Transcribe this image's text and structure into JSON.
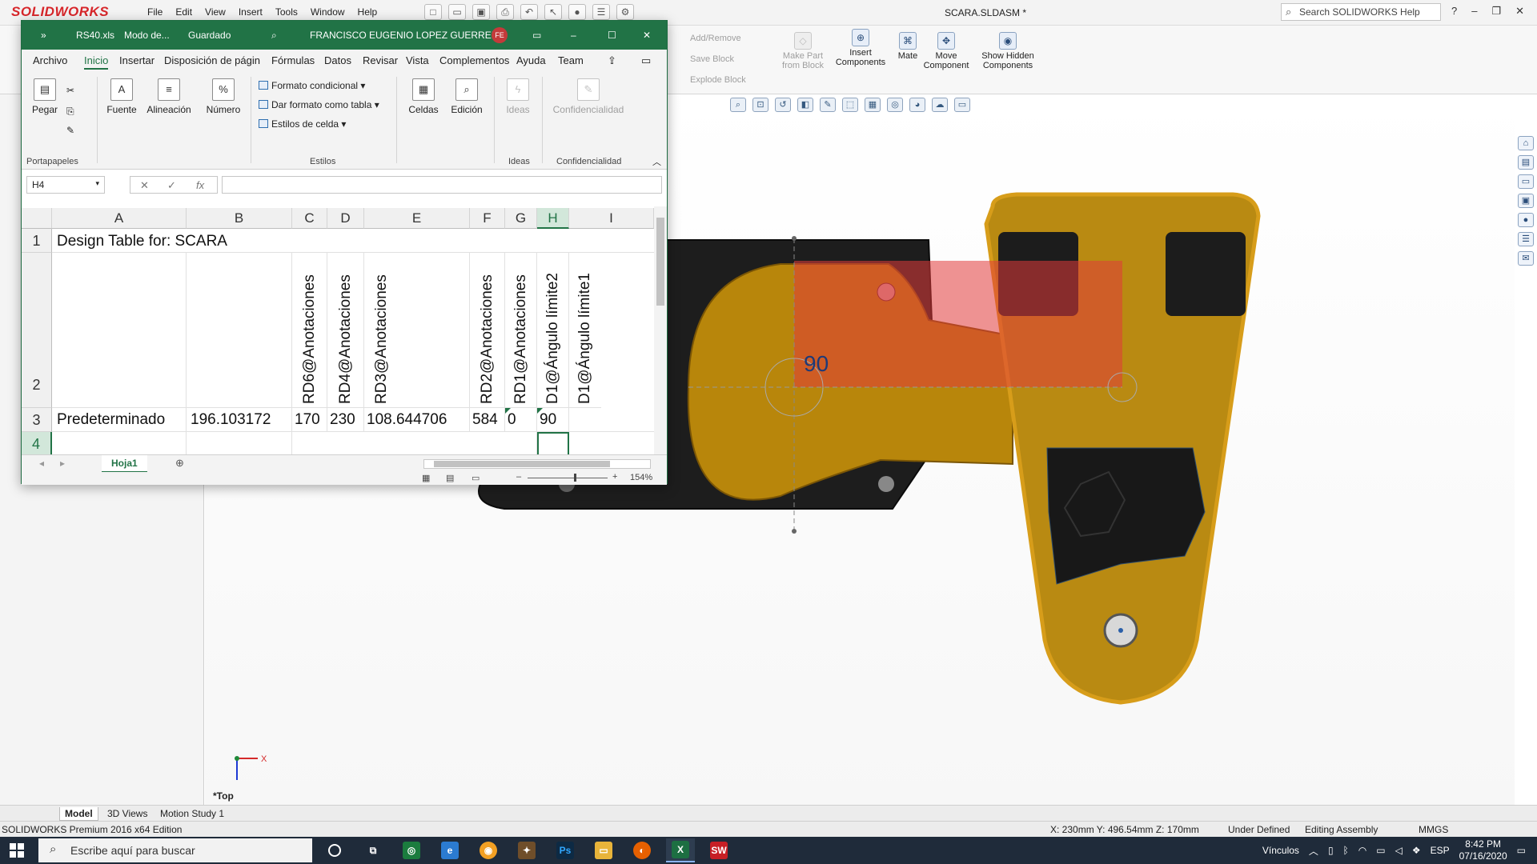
{
  "solidworks": {
    "logo": "SOLIDWORKS",
    "menu": [
      "File",
      "Edit",
      "View",
      "Insert",
      "Tools",
      "Window",
      "Help"
    ],
    "doc_title": "SCARA.SLDASM *",
    "search_placeholder": "Search SOLIDWORKS Help",
    "commands": {
      "add_remove": "Add/Remove",
      "save_block": "Save Block",
      "explode_block": "Explode Block",
      "make_part_from_block": "Make Part from Block",
      "insert_components": "Insert Components",
      "mate": "Mate",
      "move_component": "Move Component",
      "show_hidden_components": "Show Hidden Components"
    },
    "dimension_value": "90",
    "view_label": "*Top",
    "bottom_tabs": [
      "Model",
      "3D Views",
      "Motion Study 1"
    ],
    "status": {
      "edition": "SOLIDWORKS Premium 2016 x64 Edition",
      "coords": "X: 230mm Y: 496.54mm Z: 170mm",
      "definition": "Under Defined",
      "mode": "Editing Assembly",
      "units": "MMGS"
    }
  },
  "excel": {
    "title": {
      "file": "RS40.xls",
      "mode": "Modo de...",
      "saved": "Guardado",
      "user": "FRANCISCO EUGENIO LOPEZ GUERRERO",
      "initials": "FE"
    },
    "tabs": [
      "Archivo",
      "Inicio",
      "Insertar",
      "Disposición de págin",
      "Fórmulas",
      "Datos",
      "Revisar",
      "Vista",
      "Complementos",
      "Ayuda",
      "Team"
    ],
    "ribbon": {
      "paste": "Pegar",
      "clipboard_group": "Portapapeles",
      "font": "Fuente",
      "alignment": "Alineación",
      "number": "Número",
      "conditional_format": "Formato condicional",
      "format_as_table": "Dar formato como tabla",
      "cell_styles": "Estilos de celda",
      "styles_group": "Estilos",
      "cells": "Celdas",
      "editing": "Edición",
      "ideas": "Ideas",
      "ideas_group": "Ideas",
      "confidentiality": "Confidencialidad",
      "confidentiality_group": "Confidencialidad"
    },
    "name_box": "H4",
    "fx_label": "fx",
    "columns": [
      "A",
      "B",
      "C",
      "D",
      "E",
      "F",
      "G",
      "H",
      "I"
    ],
    "rows": [
      "1",
      "2",
      "3",
      "4"
    ],
    "cells": {
      "title": "Design Table for: SCARA",
      "headers": {
        "C": "RD6@Anotaciones",
        "D": "RD4@Anotaciones",
        "E": "RD3@Anotaciones",
        "F": "RD2@Anotaciones",
        "G": "RD1@Anotaciones",
        "H": "D1@Ángulo límite2",
        "I": "D1@Ángulo límite1"
      },
      "row3": {
        "A": "Predeterminado",
        "B": "196.103172",
        "C": "170",
        "D": "230",
        "E": "108.644706",
        "F": "584",
        "G": "0",
        "H": "90"
      }
    },
    "sheet_tab": "Hoja1",
    "zoom": "154%"
  },
  "taskbar": {
    "search_placeholder": "Escribe aquí para buscar",
    "tray_label": "Vínculos",
    "lang": "ESP",
    "time": "8:42 PM",
    "date": "07/16/2020"
  }
}
